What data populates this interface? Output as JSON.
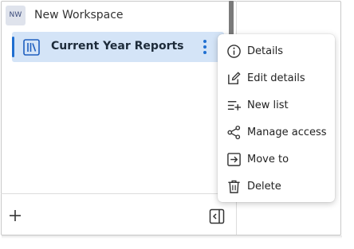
{
  "workspace": {
    "avatar_initials": "NW",
    "name": "New Workspace"
  },
  "lists": [
    {
      "label": "Current Year Reports",
      "selected": true
    }
  ],
  "context_menu": {
    "items": [
      {
        "label": "Details",
        "icon": "info-icon"
      },
      {
        "label": "Edit details",
        "icon": "edit-icon"
      },
      {
        "label": "New list",
        "icon": "add-list-icon"
      },
      {
        "label": "Manage access",
        "icon": "share-icon"
      },
      {
        "label": "Move to",
        "icon": "move-to-icon"
      },
      {
        "label": "Delete",
        "icon": "trash-icon"
      }
    ]
  },
  "colors": {
    "selected_bg": "#d4e4f7",
    "accent": "#1f6fd1",
    "avatar_bg": "#dfe3ec"
  }
}
